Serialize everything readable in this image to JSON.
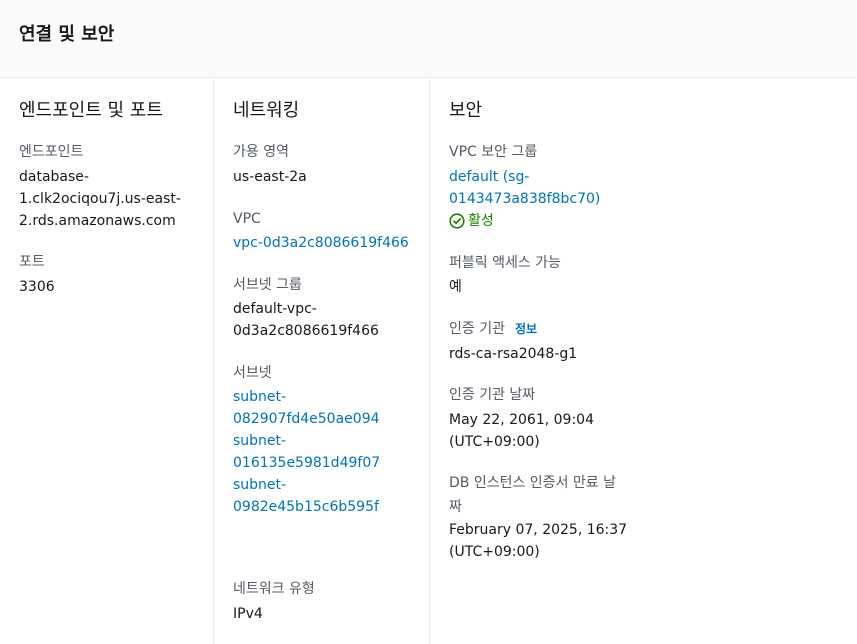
{
  "header": {
    "title": "연결 및 보안"
  },
  "endpoint_section": {
    "title": "엔드포인트 및 포트",
    "endpoint_label": "엔드포인트",
    "endpoint_lines": [
      "database-",
      "1.clk2ociqou7j.us-east-",
      "2.rds.amazonaws.com"
    ],
    "port_label": "포트",
    "port_value": "3306"
  },
  "network_section": {
    "title": "네트워킹",
    "az_label": "가용 영역",
    "az_value": "us-east-2a",
    "vpc_label": "VPC",
    "vpc_value": "vpc-0d3a2c8086619f466",
    "subnet_group_label": "서브넷 그룹",
    "subnet_group_lines": [
      "default-vpc-",
      "0d3a2c8086619f466"
    ],
    "subnets_label": "서브넷",
    "subnets": [
      {
        "lines": [
          "subnet-",
          "082907fd4e50ae094"
        ]
      },
      {
        "lines": [
          "subnet-",
          "016135e5981d49f07"
        ]
      },
      {
        "lines": [
          "subnet-",
          "0982e45b15c6b595f"
        ]
      }
    ],
    "network_type_label": "네트워크 유형",
    "network_type_value": "IPv4"
  },
  "security_section": {
    "title": "보안",
    "sg_label": "VPC 보안 그룹",
    "sg_lines": [
      "default (sg-",
      "0143473a838f8bc70)"
    ],
    "sg_status": "활성",
    "sg_status_color": "#1d8102",
    "public_access_label": "퍼블릭 액세스 가능",
    "public_access_value": "예",
    "ca_label": "인증 기관",
    "ca_info_link": "정보",
    "ca_value": "rds-ca-rsa2048-g1",
    "ca_date_label": "인증 기관 날짜",
    "ca_date_lines": [
      "May 22, 2061, 09:04",
      "(UTC+09:00)"
    ],
    "cert_expiry_label_lines": [
      "DB 인스턴스 인증서 만료 날",
      "짜"
    ],
    "cert_expiry_lines": [
      "February 07, 2025, 16:37",
      "(UTC+09:00)"
    ]
  },
  "colors": {
    "link": "#0073bb",
    "label": "#545b64",
    "text": "#16191f",
    "success": "#1d8102"
  },
  "icons": {
    "status": "check-circle-icon"
  }
}
